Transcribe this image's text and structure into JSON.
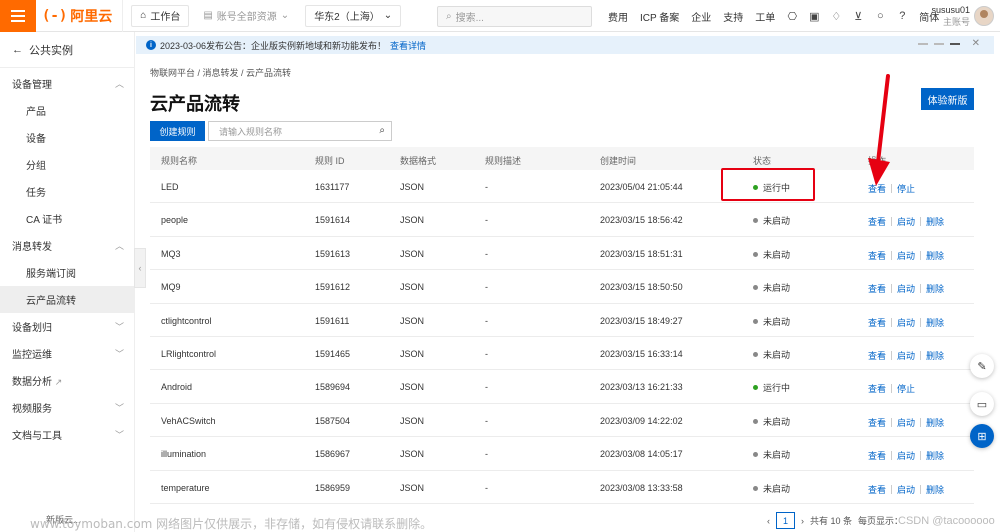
{
  "topbar": {
    "logo_mark": "(-)",
    "logo_text": "阿里云",
    "workbench": "工作台",
    "resources": "账号全部资源",
    "region": "华东2（上海）",
    "search_placeholder": "搜索...",
    "links": [
      "费用",
      "ICP 备案",
      "企业",
      "支持",
      "工单"
    ],
    "lang": "简体",
    "user_name": "sususu01",
    "user_role": "主账号"
  },
  "sidebar": {
    "back_label": "公共实例",
    "groups": [
      {
        "label": "设备管理",
        "expanded": true,
        "items": [
          "产品",
          "设备",
          "分组",
          "任务",
          "CA 证书"
        ]
      },
      {
        "label": "消息转发",
        "expanded": true,
        "items": [
          "服务端订阅",
          "云产品流转"
        ]
      },
      {
        "label": "设备划归",
        "expanded": false,
        "items": []
      },
      {
        "label": "监控运维",
        "expanded": false,
        "items": []
      },
      {
        "label": "数据分析",
        "expanded": false,
        "items": []
      },
      {
        "label": "视频服务",
        "expanded": false,
        "items": []
      },
      {
        "label": "文档与工具",
        "expanded": false,
        "items": []
      }
    ],
    "active_item": "云产品流转",
    "footer": "新版云...",
    "collapse_glyph": "‹"
  },
  "notice": {
    "text": "2023-03-06发布公告：企业版实例新地域和新功能发布！",
    "link": "查看详情"
  },
  "breadcrumb": "物联网平台  /  消息转发  /  云产品流转",
  "page_title": "云产品流转",
  "trial_button": "体验新版",
  "create_button": "创建规则",
  "search_placeholder": "请输入规则名称",
  "table": {
    "headers": [
      "规则名称",
      "规则 ID",
      "数据格式",
      "规则描述",
      "创建时间",
      "状态",
      "操作"
    ],
    "rows": [
      {
        "name": "LED",
        "id": "1631177",
        "format": "JSON",
        "desc": "-",
        "created": "2023/05/04 21:05:44",
        "status": "运行中",
        "running": true,
        "actions": [
          "查看",
          "停止"
        ]
      },
      {
        "name": "people",
        "id": "1591614",
        "format": "JSON",
        "desc": "-",
        "created": "2023/03/15 18:56:42",
        "status": "未启动",
        "running": false,
        "actions": [
          "查看",
          "启动",
          "删除"
        ]
      },
      {
        "name": "MQ3",
        "id": "1591613",
        "format": "JSON",
        "desc": "-",
        "created": "2023/03/15 18:51:31",
        "status": "未启动",
        "running": false,
        "actions": [
          "查看",
          "启动",
          "删除"
        ]
      },
      {
        "name": "MQ9",
        "id": "1591612",
        "format": "JSON",
        "desc": "-",
        "created": "2023/03/15 18:50:50",
        "status": "未启动",
        "running": false,
        "actions": [
          "查看",
          "启动",
          "删除"
        ]
      },
      {
        "name": "ctlightcontrol",
        "id": "1591611",
        "format": "JSON",
        "desc": "-",
        "created": "2023/03/15 18:49:27",
        "status": "未启动",
        "running": false,
        "actions": [
          "查看",
          "启动",
          "删除"
        ]
      },
      {
        "name": "LRlightcontrol",
        "id": "1591465",
        "format": "JSON",
        "desc": "-",
        "created": "2023/03/15 16:33:14",
        "status": "未启动",
        "running": false,
        "actions": [
          "查看",
          "启动",
          "删除"
        ]
      },
      {
        "name": "Android",
        "id": "1589694",
        "format": "JSON",
        "desc": "-",
        "created": "2023/03/13 16:21:33",
        "status": "运行中",
        "running": true,
        "actions": [
          "查看",
          "停止"
        ]
      },
      {
        "name": "VehACSwitch",
        "id": "1587504",
        "format": "JSON",
        "desc": "-",
        "created": "2023/03/09 14:22:02",
        "status": "未启动",
        "running": false,
        "actions": [
          "查看",
          "启动",
          "删除"
        ]
      },
      {
        "name": "illumination",
        "id": "1586967",
        "format": "JSON",
        "desc": "-",
        "created": "2023/03/08 14:05:17",
        "status": "未启动",
        "running": false,
        "actions": [
          "查看",
          "启动",
          "删除"
        ]
      },
      {
        "name": "temperature",
        "id": "1586959",
        "format": "JSON",
        "desc": "-",
        "created": "2023/03/08 13:33:58",
        "status": "未启动",
        "running": false,
        "actions": [
          "查看",
          "启动",
          "删除"
        ]
      }
    ]
  },
  "pager": {
    "page": "1",
    "total": "共有 10 条",
    "per_page": "每页显示："
  },
  "watermark": "www.toymoban.com 网络图片仅供展示，非存储，如有侵权请联系删除。",
  "watermark_right": "CSDN @tacoooooo",
  "colors": {
    "brand": "#ff6a00",
    "primary": "#0064c8",
    "running": "#2ea121",
    "highlight": "#e60012"
  }
}
